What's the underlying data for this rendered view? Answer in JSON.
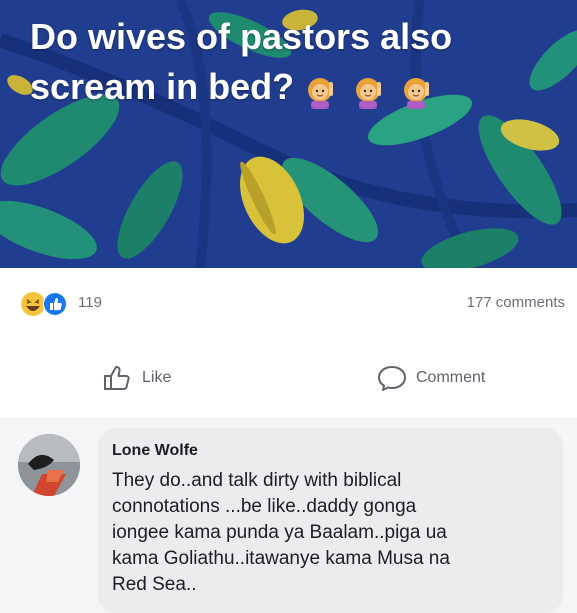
{
  "post": {
    "caption_line1": "Do wives of pastors also",
    "caption_line2": "scream in bed?",
    "caption_emoji": [
      "woman-raising-hand-emoji",
      "woman-raising-hand-emoji",
      "woman-raising-hand-emoji"
    ],
    "background_color": "#213d8f"
  },
  "reactions": {
    "icons": [
      "haha-reaction-icon",
      "like-reaction-icon"
    ],
    "count": "119",
    "comments_count": "177 comments"
  },
  "actions": {
    "like_label": "Like",
    "comment_label": "Comment"
  },
  "comment": {
    "author": "Lone Wolfe",
    "text_lines": [
      "They do..and talk dirty with biblical",
      "connotations ...be like..daddy gonga",
      "iongee kama punda ya Baalam..piga ua",
      "kama Goliathu..itawanye kama Musa na",
      "Red Sea.."
    ]
  },
  "colors": {
    "like_blue": "#1877f2",
    "haha_yellow": "#f7c33c",
    "text_gray": "#65676b"
  }
}
